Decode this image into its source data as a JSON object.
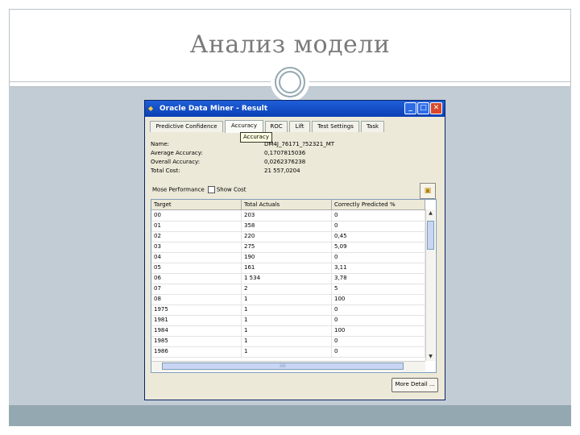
{
  "slide": {
    "title": "Анализ модели",
    "colors": {
      "frame": "#b9c2c8",
      "content_bg": "#c2ccd4",
      "footer_band": "#94a8b1"
    }
  },
  "window": {
    "title": "Oracle Data Miner - Result",
    "controls": {
      "minimize": "_",
      "maximize": "□",
      "close": "✕"
    },
    "tabs": [
      {
        "label": "Predictive Confidence"
      },
      {
        "label": "Accuracy"
      },
      {
        "label": "ROC"
      },
      {
        "label": "Lift"
      },
      {
        "label": "Test Settings"
      },
      {
        "label": "Task"
      }
    ],
    "active_tab": "Accuracy",
    "tooltip": "Accuracy",
    "info": [
      {
        "label": "Name:",
        "value": "DM4J_76171_?52321_MT"
      },
      {
        "label": "Average Accuracy:",
        "value": "0,1707815036"
      },
      {
        "label": "Overall Accuracy:",
        "value": "0,0262376238"
      },
      {
        "label": "Total Cost:",
        "value": "21 557,0204"
      }
    ],
    "mode_label": "Mose Performance",
    "show_cost_label": "Show Cost",
    "grid": {
      "columns": [
        "Target",
        "Total Actuals",
        "Correctly Predicted %"
      ],
      "rows": [
        [
          "00",
          "203",
          "0"
        ],
        [
          "01",
          "358",
          "0"
        ],
        [
          "02",
          "220",
          "0,45"
        ],
        [
          "03",
          "275",
          "5,09"
        ],
        [
          "04",
          "190",
          "0"
        ],
        [
          "05",
          "161",
          "3,11"
        ],
        [
          "06",
          "1 534",
          "3,78"
        ],
        [
          "07",
          "2",
          "5"
        ],
        [
          "08",
          "1",
          "100"
        ],
        [
          "1975",
          "1",
          "0"
        ],
        [
          "1981",
          "1",
          "0"
        ],
        [
          "1984",
          "1",
          "100"
        ],
        [
          "1985",
          "1",
          "0"
        ],
        [
          "1986",
          "1",
          "0"
        ]
      ]
    },
    "more_button": "More Detail ..."
  }
}
